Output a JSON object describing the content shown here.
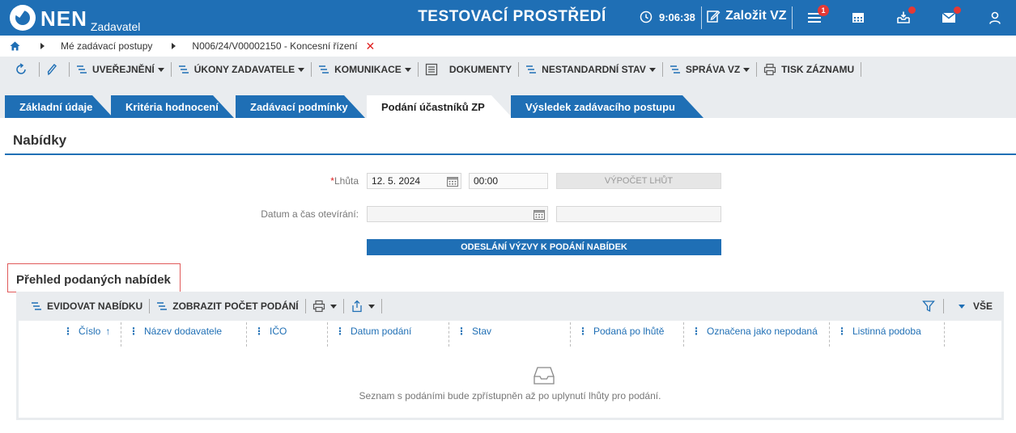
{
  "header": {
    "logo_text": "NEN",
    "logo_sub": "Zadavatel",
    "env_title": "TESTOVACÍ PROSTŘEDÍ",
    "time": "9:06:38",
    "create_label": "Založit VZ",
    "menu_badge": "1",
    "icons": [
      "clock-icon",
      "edit-icon",
      "hamburger-menu-icon",
      "calculator-icon",
      "inbox-download-icon",
      "mail-icon",
      "user-icon"
    ]
  },
  "breadcrumb": {
    "item1": "Mé zadávací postupy",
    "item2": "N006/24/V00002150 - Koncesní řízení",
    "close": "✕"
  },
  "toolbar": {
    "publish": "UVEŘEJNĚNÍ",
    "actions": "ÚKONY ZADAVATELE",
    "communication": "KOMUNIKACE",
    "documents": "DOKUMENTY",
    "nonstandard": "NESTANDARDNÍ STAV",
    "management": "SPRÁVA VZ",
    "print": "TISK ZÁZNAMU"
  },
  "tabs": [
    {
      "label": "Základní údaje"
    },
    {
      "label": "Kritéria hodnocení"
    },
    {
      "label": "Zadávací podmínky"
    },
    {
      "label": "Podání účastníků ZP"
    },
    {
      "label": "Výsledek zadávacího postupu"
    }
  ],
  "section": {
    "title": "Nabídky"
  },
  "form": {
    "deadline_required": "*",
    "deadline_label": "Lhůta",
    "deadline_date": "12. 5. 2024",
    "deadline_time": "00:00",
    "calc_button": "VÝPOČET LHŮT",
    "opening_label": "Datum a čas otevírání:",
    "opening_date": "",
    "opening_time": "",
    "send_button": "ODESLÁNÍ VÝZVY K PODÁNÍ NABÍDEK"
  },
  "grid": {
    "title": "Přehled podaných nabídek",
    "toolbar": {
      "register": "EVIDOVAT NABÍDKU",
      "show_count": "ZOBRAZIT POČET PODÁNÍ",
      "filter_all": "VŠE"
    },
    "columns": [
      "Číslo",
      "Název dodavatele",
      "IČO",
      "Datum podání",
      "Stav",
      "Podaná po lhůtě",
      "Označena jako nepodaná",
      "Listinná podoba"
    ],
    "sort_indicator": "↑",
    "empty_text": "Seznam s podáními bude zpřístupněn až po uplynutí lhůty pro podání."
  },
  "colors": {
    "brand_blue": "#1f6fb5",
    "toolbar_grey": "#e9ecef",
    "required_red": "#e02020",
    "highlight_red": "#e05a5a"
  }
}
